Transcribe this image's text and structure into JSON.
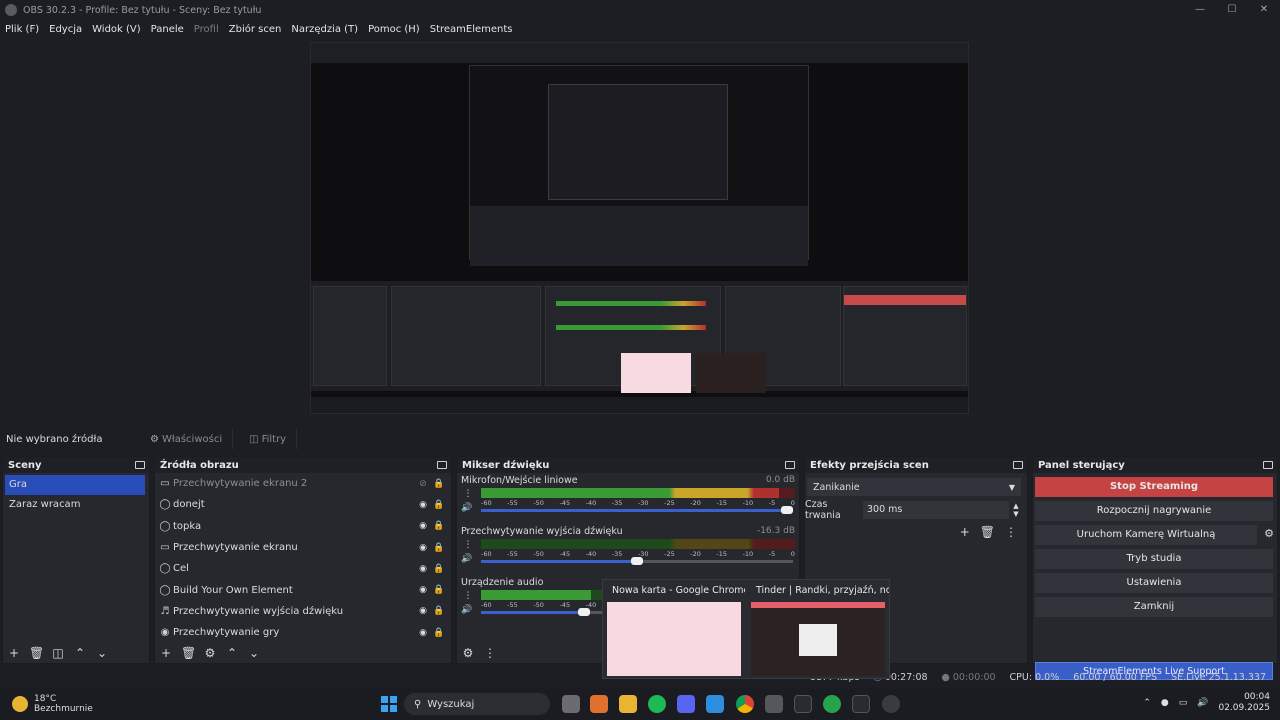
{
  "window": {
    "title": "OBS 30.2.3 - Profile: Bez tytułu - Sceny: Bez tytułu"
  },
  "menu": [
    "Plik (F)",
    "Edycja",
    "Widok (V)",
    "Panele",
    "Profil",
    "Zbiór scen",
    "Narzędzia (T)",
    "Pomoc (H)",
    "StreamElements"
  ],
  "sourcebar": {
    "no_source": "Nie wybrano źródła",
    "properties": "Właściwości",
    "filters": "Filtry"
  },
  "scenes": {
    "title": "Sceny",
    "items": [
      "Gra",
      "Zaraz wracam"
    ]
  },
  "sources": {
    "title": "Źródła obrazu",
    "items": [
      {
        "label": "Przechwytywanie ekranu 2",
        "icon": "monitor-icon"
      },
      {
        "label": "donejt",
        "icon": "globe-icon"
      },
      {
        "label": "topka",
        "icon": "globe-icon"
      },
      {
        "label": "Przechwytywanie ekranu",
        "icon": "monitor-icon"
      },
      {
        "label": "Cel",
        "icon": "globe-icon"
      },
      {
        "label": "Build Your Own Element",
        "icon": "globe-icon"
      },
      {
        "label": "Przechwytywanie wyjścia dźwięku",
        "icon": "speaker-icon"
      },
      {
        "label": "Przechwytywanie gry",
        "icon": "gamepad-icon"
      }
    ]
  },
  "mixer": {
    "title": "Mikser dźwięku",
    "channels": [
      {
        "name": "Mikrofon/Wejście liniowe",
        "db": "0.0 dB",
        "level": 0.95,
        "volume": 1.0
      },
      {
        "name": "Przechwytywanie wyjścia dźwięku",
        "db": "-16.3 dB",
        "level": 0.0,
        "volume": 0.52
      },
      {
        "name": "Urządzenie audio",
        "db": "",
        "level": 0.35,
        "volume": 0.35
      }
    ],
    "ticks": [
      "-60",
      "-55",
      "-50",
      "-45",
      "-40",
      "-35",
      "-30",
      "-25",
      "-20",
      "-15",
      "-10",
      "-5",
      "0"
    ]
  },
  "transitions": {
    "title": "Efekty przejścia scen",
    "selected": "Zanikanie",
    "duration_label": "Czas trwania",
    "duration": "300 ms"
  },
  "controls": {
    "title": "Panel sterujący",
    "stop_streaming": "Stop Streaming",
    "start_recording": "Rozpocznij nagrywanie",
    "virtual_camera": "Uruchom Kamerę Wirtualną",
    "studio_mode": "Tryb studia",
    "settings": "Ustawienia",
    "exit": "Zamknij",
    "se_support": "StreamElements Live Support"
  },
  "status": {
    "kbps": "8177 kbps",
    "stream_time": "00:27:08",
    "rec_time": "00:00:00",
    "cpu": "CPU: 0.0%",
    "fps": "60.00 / 60.00 FPS",
    "se_version": "SE.Live 25.1.13.337"
  },
  "taskbar": {
    "temp": "18°C",
    "weather": "Bezchmurnie",
    "search": "Wyszukaj",
    "time": "00:04",
    "date": "02.09.2025"
  },
  "chrome_popup": {
    "tab1": "Nowa karta - Google Chrome",
    "tab2": "Tinder | Randki, przyjaźń, no..."
  },
  "colors": {
    "accent": "#284cb8",
    "stop": "#c54343",
    "se_blue": "#3a5ec7"
  }
}
